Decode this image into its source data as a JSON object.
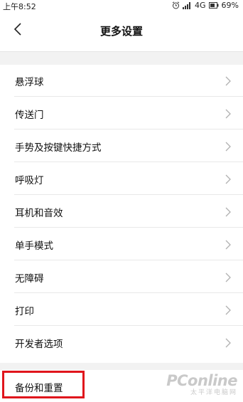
{
  "status_bar": {
    "time": "上午8:52",
    "network": "4G",
    "battery": "69%",
    "icons": [
      "alarm-icon",
      "signal-icon",
      "network-4g-icon",
      "battery-icon"
    ]
  },
  "header": {
    "title": "更多设置",
    "back_icon": "back-chevron-icon"
  },
  "settings_items": [
    {
      "label": "悬浮球"
    },
    {
      "label": "传送门"
    },
    {
      "label": "手势及按键快捷方式"
    },
    {
      "label": "呼吸灯"
    },
    {
      "label": "耳机和音效"
    },
    {
      "label": "单手模式"
    },
    {
      "label": "无障碍"
    },
    {
      "label": "打印"
    },
    {
      "label": "开发者选项"
    }
  ],
  "backup_item": {
    "label": "备份和重置",
    "highlight_color": "#e0151c"
  },
  "watermark": {
    "brand": "PConline",
    "subtitle": "太平洋电脑网"
  },
  "colors": {
    "background": "#ffffff",
    "section_gap": "#f2f2f2",
    "divider": "#e8e8e8",
    "chevron": "#b0b0b0",
    "highlight": "#e0151c"
  }
}
